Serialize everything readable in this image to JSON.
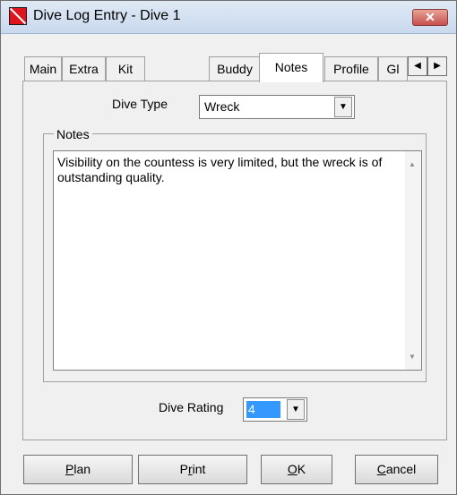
{
  "window": {
    "title": "Dive Log Entry - Dive 1",
    "close_glyph": "✕"
  },
  "tabs": [
    {
      "label": "Main"
    },
    {
      "label": "Extra"
    },
    {
      "label": "Kit"
    },
    {
      "label": "Buddy"
    },
    {
      "label": "Notes",
      "active": true
    },
    {
      "label": "Profile"
    },
    {
      "label": "Gl"
    }
  ],
  "tab_scroll": {
    "left_glyph": "◀",
    "right_glyph": "▶"
  },
  "dive_type": {
    "label": "Dive Type",
    "value": "Wreck"
  },
  "notes": {
    "group_label": "Notes",
    "text": "Visibility on the countess is very limited, but the wreck is of outstanding quality."
  },
  "dive_rating": {
    "label": "Dive Rating",
    "value": "4"
  },
  "buttons": {
    "plan": {
      "first": "P",
      "rest": "lan"
    },
    "print": {
      "before": "P",
      "u": "r",
      "after": "int"
    },
    "ok": {
      "first": "O",
      "rest": "K"
    },
    "cancel": {
      "first": "C",
      "rest": "ancel"
    }
  },
  "colors": {
    "selection": "#3399ff",
    "close_button": "#c75050",
    "app_icon": "#e0141c"
  },
  "icons": {
    "app": "dive-log-app-icon",
    "close": "close-icon",
    "dropdown": "chevron-down-icon"
  }
}
